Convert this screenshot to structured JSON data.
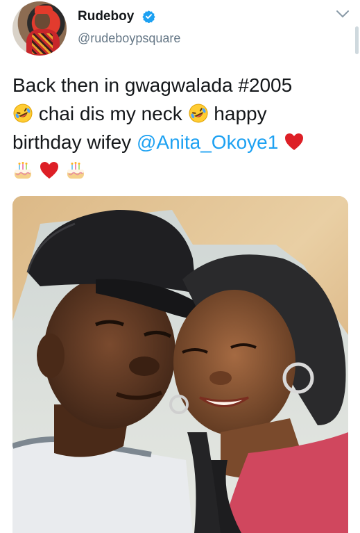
{
  "profile": {
    "display_name": "Rudeboy",
    "handle": "@rudeboypsquare",
    "verified": true,
    "avatar_icon": "avatar-photo"
  },
  "tweet": {
    "line1": "Back then in gwagwalada #2005",
    "line2_text": " chai dis my neck ",
    "line2_end": " happy",
    "line3_text": "birthday wifey ",
    "mention": "@Anita_Okoye1",
    "emojis": {
      "laugh": "rolling-on-floor-laughing-icon",
      "heart": "red-heart-icon",
      "cake": "birthday-cake-icon"
    }
  },
  "media": {
    "photo_icon": "tweet-photo"
  },
  "colors": {
    "link": "#1da1f2",
    "secondary_text": "#657786",
    "heart": "#e0245e",
    "verified": "#1da1f2"
  }
}
